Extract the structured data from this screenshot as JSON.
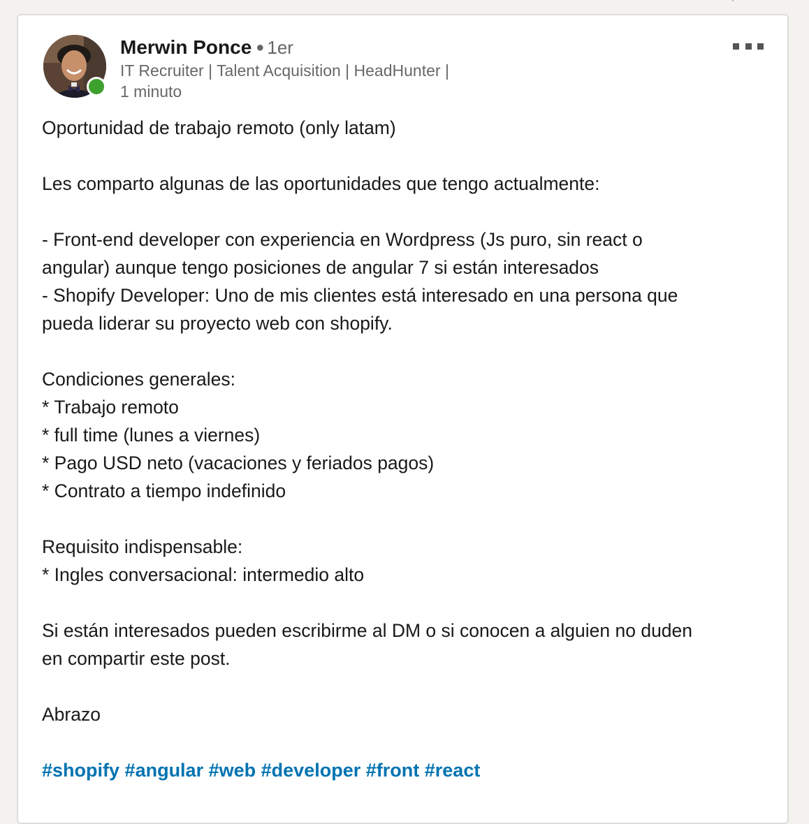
{
  "post": {
    "author": {
      "name": "Merwin Ponce",
      "degree": "1er",
      "headline": "IT Recruiter | Talent Acquisition | HeadHunter |",
      "time": "1 minuto",
      "presence_color": "#3ea02d"
    },
    "menu_icon": "ellipsis-icon",
    "lines": [
      "Oportunidad de trabajo remoto (only latam)",
      "",
      "Les comparto algunas de las oportunidades que tengo actualmente:",
      "",
      "- Front-end developer con experiencia en Wordpress (Js puro, sin react o",
      "angular) aunque tengo posiciones de angular 7 si están interesados",
      "- Shopify Developer: Uno de mis clientes está interesado en una persona que",
      "pueda liderar su proyecto web con shopify.",
      "",
      "Condiciones generales:",
      "* Trabajo remoto",
      "* full time (lunes a viernes)",
      "* Pago USD neto (vacaciones y feriados pagos)",
      "* Contrato a tiempo indefinido",
      "",
      "Requisito indispensable:",
      "* Ingles conversacional: intermedio alto",
      "",
      "Si están interesados pueden escribirme al DM o si conocen a alguien no duden",
      "en compartir este post.",
      "",
      "Abrazo"
    ],
    "hashtags": [
      "#shopify",
      "#angular",
      "#web",
      "#developer",
      "#front",
      "#react"
    ],
    "hashtag_color": "#0073b1"
  }
}
